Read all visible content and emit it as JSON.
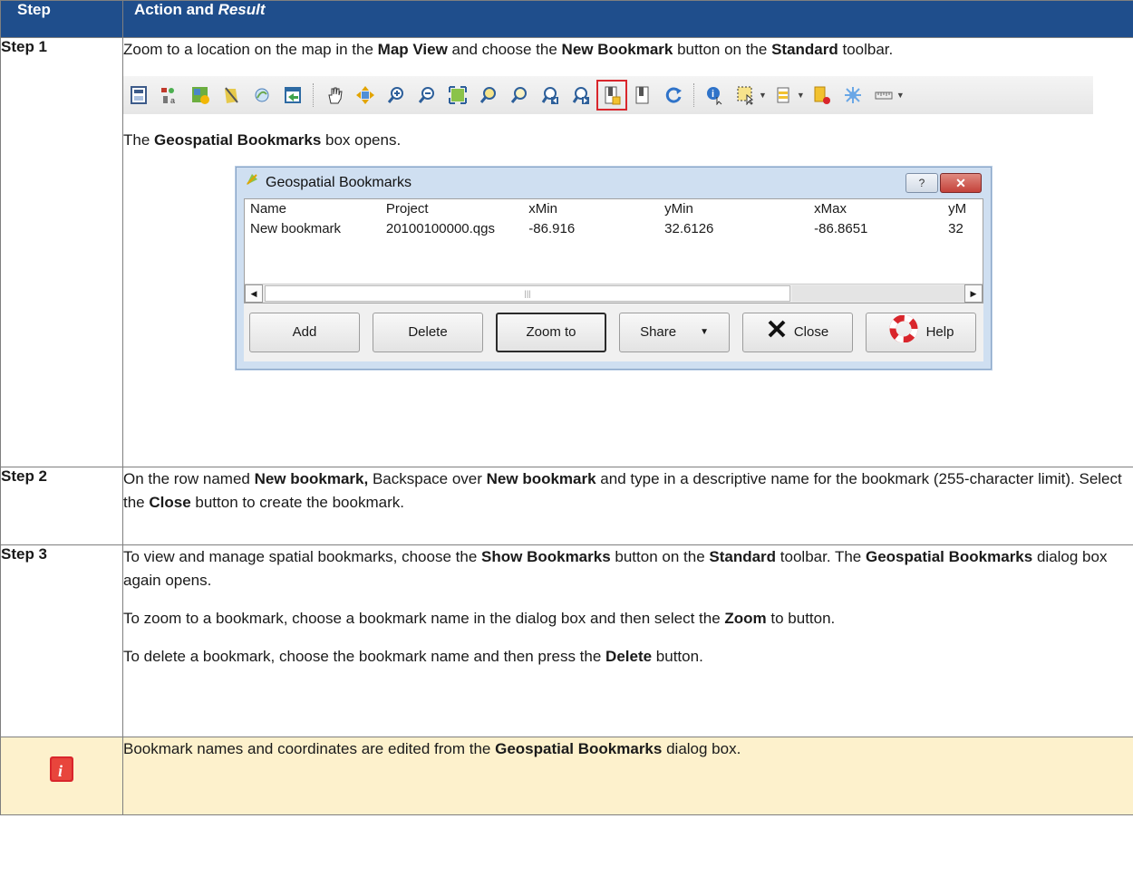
{
  "table": {
    "header": {
      "step": "Step",
      "action": "Action and ",
      "action_italic": "Result"
    },
    "steps": [
      {
        "label": "Step 1",
        "p1": {
          "a": "Zoom to a location on the map in the ",
          "b1": "Map View",
          "c": " and choose the ",
          "b2": "New Bookmark",
          "d": " button on the ",
          "b3": "Standard",
          "e": " toolbar."
        },
        "p2": {
          "a": "The ",
          "b1": "Geospatial Bookmarks",
          "c": " box opens."
        }
      },
      {
        "label": "Step 2",
        "p1": {
          "a": "On the row named ",
          "b1": "New bookmark,",
          "c": " Backspace over ",
          "b2": "New bookmark",
          "d": " and type in a descriptive name for the bookmark (255-character limit). Select the ",
          "b3": "Close",
          "e": " button to create the bookmark."
        }
      },
      {
        "label": "Step 3",
        "p1": {
          "a": "To view and manage spatial bookmarks, choose the ",
          "b1": "Show Bookmarks",
          "c": " button on the ",
          "b2": "Standard",
          "d": " toolbar. The ",
          "b3": "Geospatial Bookmarks",
          "e": " dialog box again opens."
        },
        "p2": {
          "a": "To zoom to a bookmark, choose a bookmark name in the dialog box and then select the ",
          "b1": "Zoom",
          "c": " to button."
        },
        "p3": {
          "a": "To delete a bookmark, choose the bookmark name and then press the ",
          "b1": "Delete",
          "c": " button."
        }
      }
    ],
    "tip": {
      "a": "Bookmark names and coordinates are edited from the ",
      "b1": "Geospatial Bookmarks",
      "c": " dialog box."
    }
  },
  "dialog": {
    "title": "Geospatial Bookmarks",
    "help_btn": "?",
    "close_btn": "✕",
    "columns": [
      "Name",
      "Project",
      "xMin",
      "yMin",
      "xMax",
      "yM"
    ],
    "rows": [
      [
        "New bookmark",
        "20100100000.qgs",
        "-86.916",
        "32.6126",
        "-86.8651",
        "32"
      ]
    ],
    "buttons": {
      "add": "Add",
      "delete": "Delete",
      "zoom": "Zoom to",
      "share": "Share",
      "close": "Close",
      "help": "Help"
    }
  },
  "toolbar_icons": [
    "save-project-icon",
    "project-properties-icon",
    "new-print-composer-icon",
    "composer-manager-icon",
    "style-manager-icon",
    "open-data-source-icon",
    "pan-icon",
    "pan-to-selection-icon",
    "zoom-in-icon",
    "zoom-out-icon",
    "zoom-full-icon",
    "zoom-to-selection-icon",
    "zoom-to-layer-icon",
    "zoom-last-icon",
    "zoom-next-icon",
    "new-bookmark-icon",
    "show-bookmarks-icon",
    "refresh-icon",
    "identify-icon",
    "select-features-icon",
    "open-attribute-table-icon",
    "deselect-icon",
    "action-icon",
    "measure-icon"
  ],
  "colors": {
    "header_bg": "#1f4e8c",
    "tip_bg": "#fdf1cc",
    "highlight": "#d9262c"
  }
}
